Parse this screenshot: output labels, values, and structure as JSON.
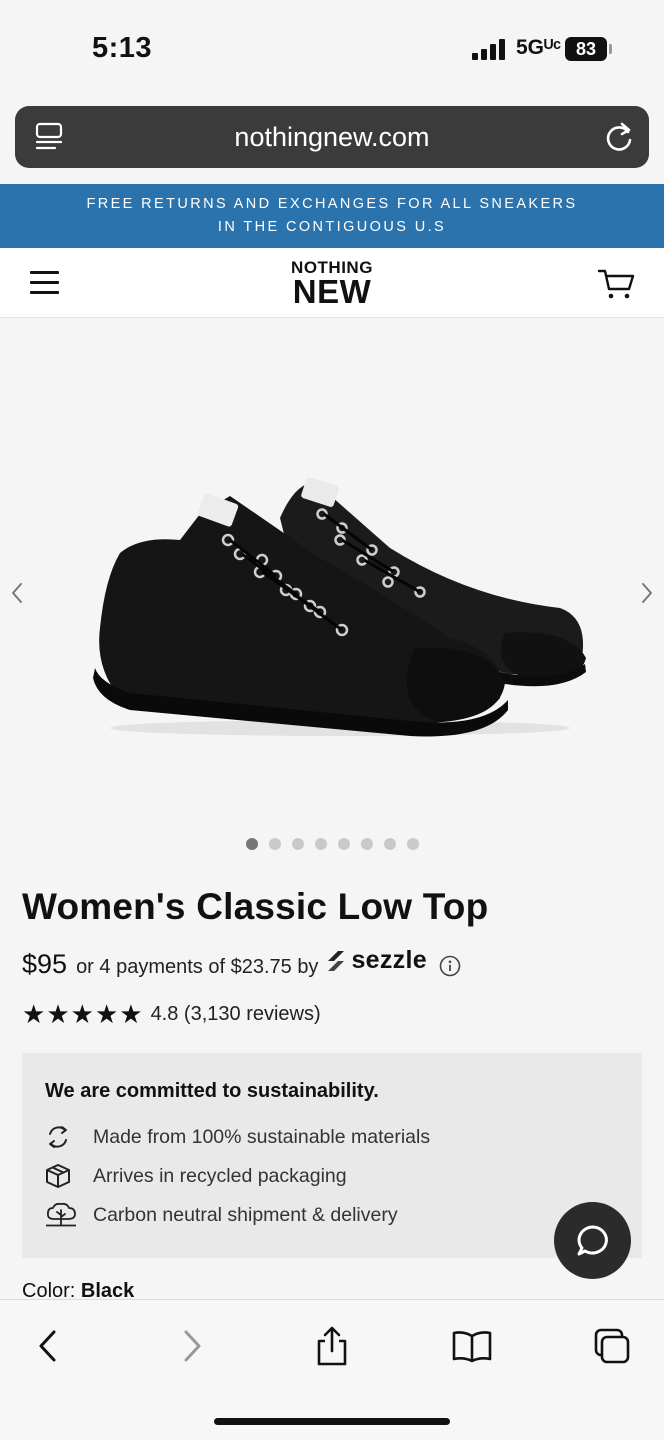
{
  "status_bar": {
    "time": "5:13",
    "network": "5Gᵁᶜ",
    "battery": "83"
  },
  "browser": {
    "url": "nothingnew.com"
  },
  "promo_banner": {
    "line1": "FREE RETURNS AND EXCHANGES FOR ALL SNEAKERS",
    "line2": "IN THE CONTIGUOUS U.S"
  },
  "site_header": {
    "logo_top": "NOTHING",
    "logo_bottom": "NEW"
  },
  "gallery": {
    "image_count": 8,
    "active_index": 0
  },
  "product": {
    "title": "Women's Classic Low Top",
    "price": "$95",
    "installments_text": "or 4 payments of $23.75 by",
    "payment_provider": "sezzle",
    "rating_value": 4.8,
    "rating_text": "4.8 (3,130 reviews)",
    "color_label": "Color:",
    "color_value": "Black"
  },
  "sustainability": {
    "title": "We are committed to sustainability.",
    "items": [
      {
        "icon": "recycle-icon",
        "label": "Made from 100% sustainable materials"
      },
      {
        "icon": "box-icon",
        "label": "Arrives in recycled packaging"
      },
      {
        "icon": "tree-icon",
        "label": "Carbon neutral shipment & delivery"
      }
    ]
  },
  "colors": {
    "banner": "#2b73ad",
    "url_bar": "#3b3b3b",
    "box_bg": "#e9e9e9",
    "chat_button": "#2b2b2b"
  }
}
